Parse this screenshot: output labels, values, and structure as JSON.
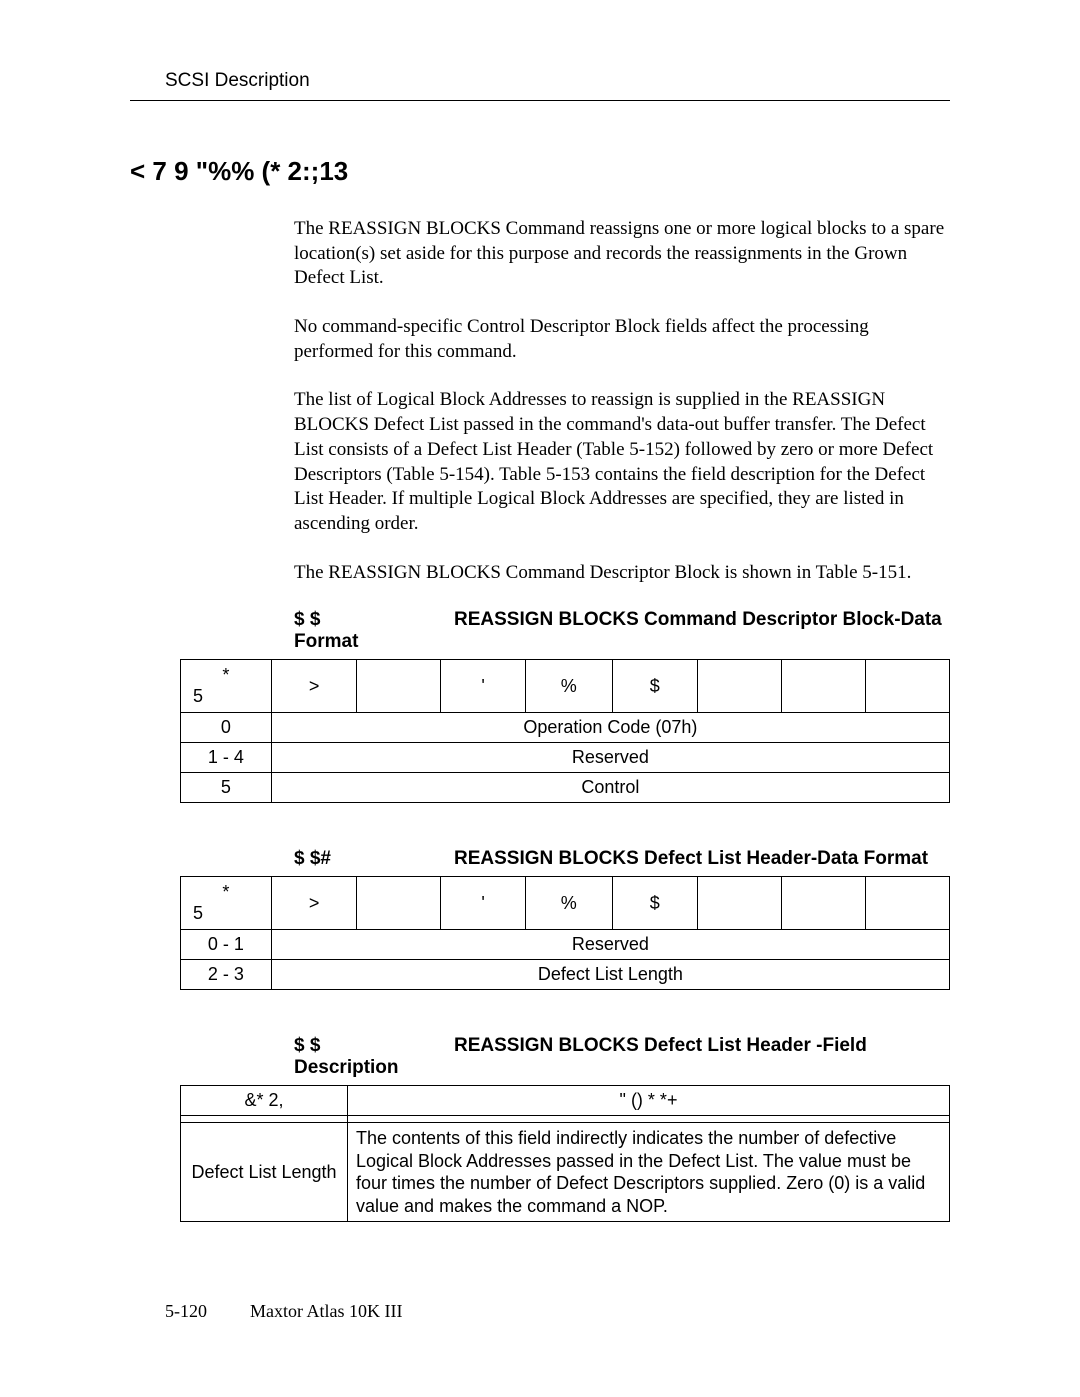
{
  "header": {
    "running_head": "SCSI Description"
  },
  "section": {
    "heading": "< 7           9     \"%% (* 2:;13"
  },
  "paragraphs": {
    "p1": "The REASSIGN BLOCKS Command reassigns one or more logical blocks to a spare location(s) set aside for this purpose and records the reassignments in the Grown Defect List.",
    "p2": "No command-specific Control Descriptor Block fields affect the processing performed for this command.",
    "p3": "The list of Logical Block Addresses to reassign is supplied in the REASSIGN BLOCKS Defect List passed in the command's data-out buffer transfer. The Defect List consists of a Defect List Header (Table 5-152) followed by zero or more Defect Descriptors (Table 5-154). Table 5-153 contains the field description for the Defect List Header. If multiple Logical Block Addresses are specified, they are listed in ascending order.",
    "p4": "The REASSIGN BLOCKS Command Descriptor Block is shown in Table 5-151."
  },
  "table151": {
    "caption_prefix": "$  $",
    "caption": "REASSIGN BLOCKS Command Descriptor Block-Data Format",
    "corner_top": "*",
    "corner_bottom": "5",
    "bits": [
      ">",
      "",
      "'",
      "%",
      "$",
      "",
      "",
      ""
    ],
    "rows": [
      {
        "byte": "0",
        "value": "Operation Code (07h)"
      },
      {
        "byte": "1 - 4",
        "value": "Reserved"
      },
      {
        "byte": "5",
        "value": "Control"
      }
    ]
  },
  "table152": {
    "caption_prefix": "$  $#",
    "caption": "REASSIGN BLOCKS Defect List Header-Data Format",
    "corner_top": "*",
    "corner_bottom": "5",
    "bits": [
      ">",
      "",
      "'",
      "%",
      "$",
      "",
      "",
      ""
    ],
    "rows": [
      {
        "byte": "0 - 1",
        "value": "Reserved"
      },
      {
        "byte": "2 - 3",
        "value": "Defect List Length"
      }
    ]
  },
  "table153": {
    "caption_prefix": "$  $",
    "caption": "REASSIGN BLOCKS Defect List Header -Field Description",
    "col_field": "&* 2,",
    "col_desc": "\" () *  *+",
    "rows": [
      {
        "field": "Defect List Length",
        "desc": "The contents of this field indirectly indicates the number of defective Logical Block Addresses passed in the Defect List. The value must be four times the number of Defect Descriptors supplied. Zero (0) is a valid value and makes the command a NOP."
      }
    ]
  },
  "footer": {
    "page": "5-120",
    "title": "Maxtor Atlas 10K III"
  }
}
